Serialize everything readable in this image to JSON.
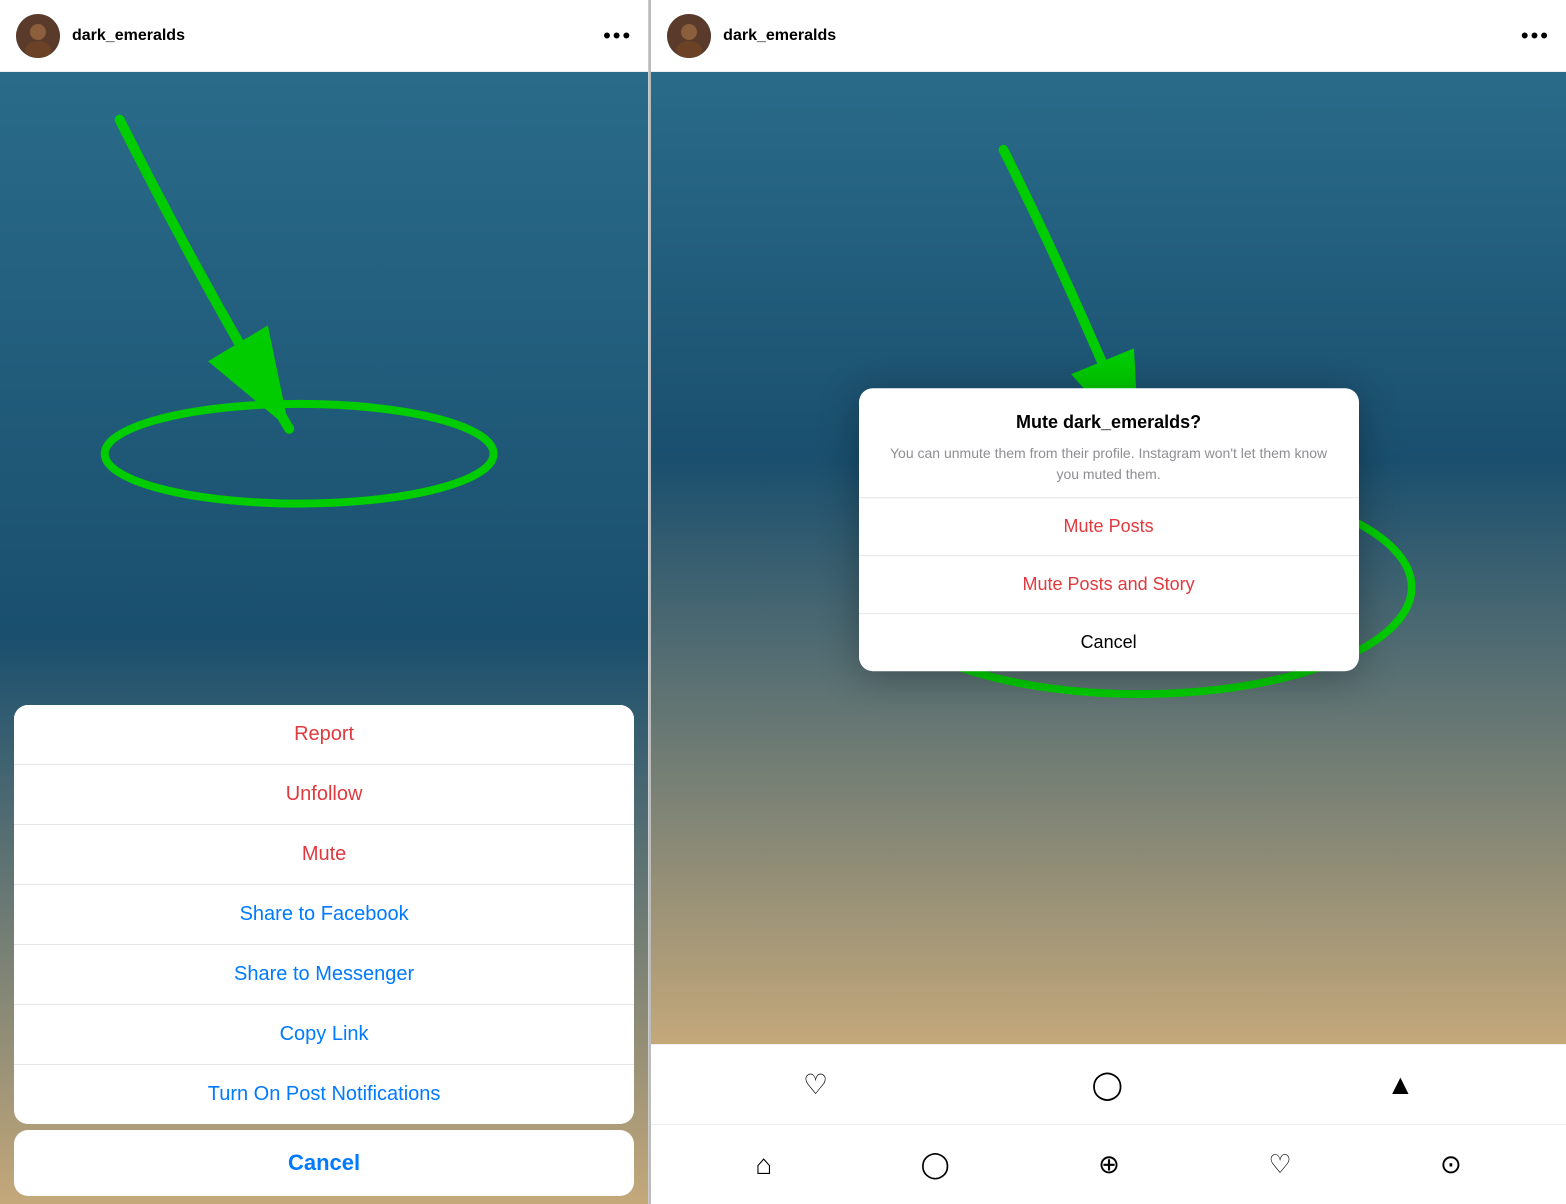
{
  "left": {
    "header": {
      "username": "dark_emeralds",
      "more_label": "•••"
    },
    "action_sheet": {
      "items": [
        {
          "id": "report",
          "label": "Report",
          "style": "red"
        },
        {
          "id": "unfollow",
          "label": "Unfollow",
          "style": "red"
        },
        {
          "id": "mute",
          "label": "Mute",
          "style": "red"
        },
        {
          "id": "share-facebook",
          "label": "Share to Facebook",
          "style": "blue"
        },
        {
          "id": "share-messenger",
          "label": "Share to Messenger",
          "style": "blue"
        },
        {
          "id": "copy-link",
          "label": "Copy Link",
          "style": "blue"
        },
        {
          "id": "notifications",
          "label": "Turn On Post Notifications",
          "style": "blue"
        }
      ],
      "cancel_label": "Cancel"
    }
  },
  "right": {
    "header": {
      "username": "dark_emeralds",
      "more_label": "•••"
    },
    "mute_dialog": {
      "title": "Mute dark_emeralds?",
      "description": "You can unmute them from their profile. Instagram won't let them know you muted them.",
      "items": [
        {
          "id": "mute-posts",
          "label": "Mute Posts",
          "style": "red"
        },
        {
          "id": "mute-posts-story",
          "label": "Mute Posts and Story",
          "style": "red"
        },
        {
          "id": "cancel",
          "label": "Cancel",
          "style": "black"
        }
      ]
    },
    "bottom_bar": {
      "icons": [
        "♡",
        "○",
        "◁"
      ]
    },
    "bottom_nav": {
      "icons": [
        "⌂",
        "○",
        "⊕",
        "♡",
        "⊙"
      ]
    }
  }
}
